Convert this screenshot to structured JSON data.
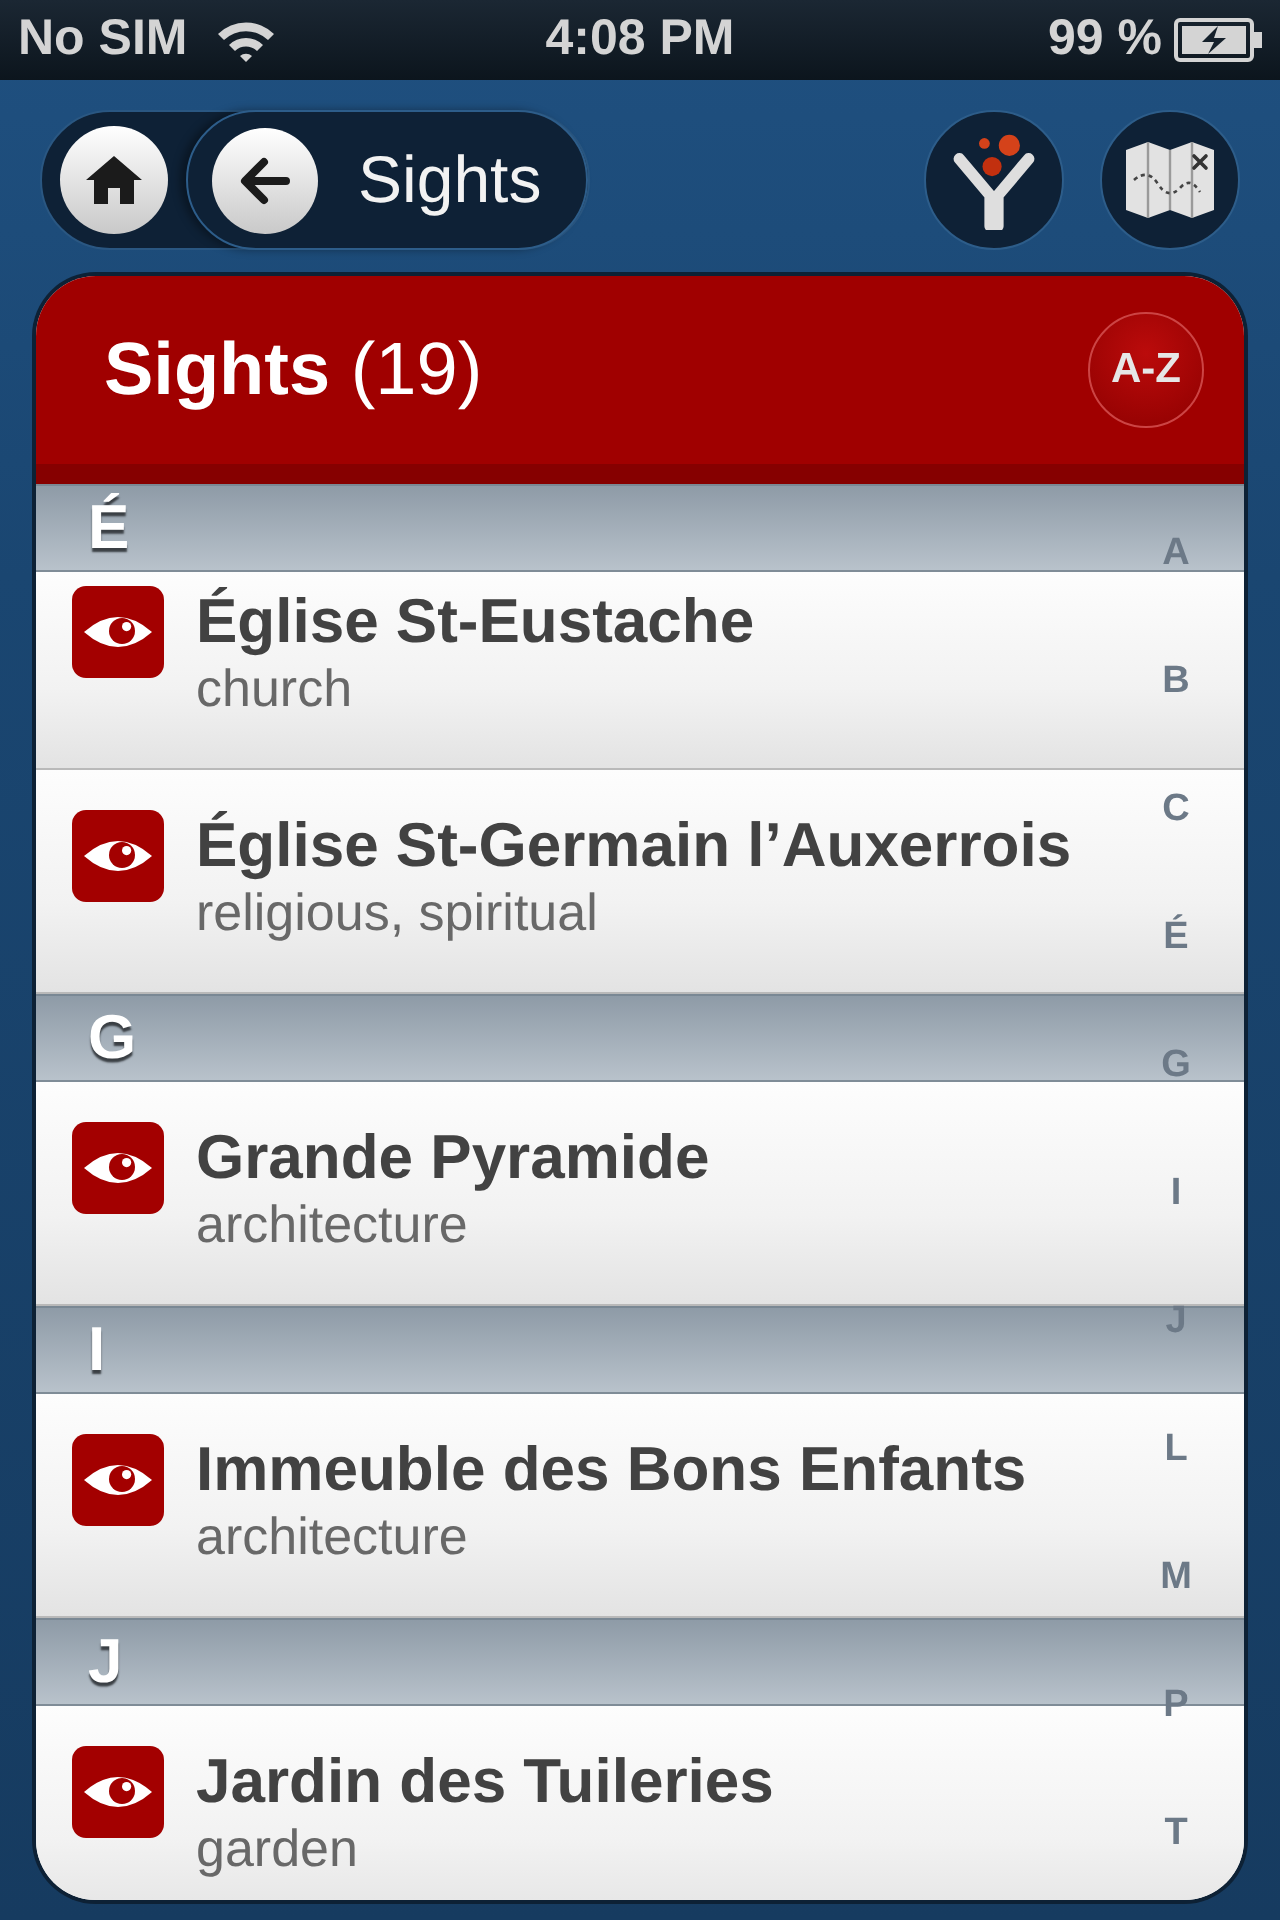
{
  "status_bar": {
    "carrier": "No SIM",
    "time": "4:08 PM",
    "battery": "99 %"
  },
  "nav": {
    "back_label": "Sights"
  },
  "header": {
    "title": "**Sights** (19)",
    "sort_label": "A-Z"
  },
  "sections": [
    {
      "letter": "É",
      "items": [
        {
          "name": "Église St-Eustache",
          "category": "church"
        },
        {
          "name": "Église St-Germain l’Auxerrois",
          "category": "religious, spiritual"
        }
      ]
    },
    {
      "letter": "G",
      "items": [
        {
          "name": "Grande Pyramide",
          "category": "architecture"
        }
      ]
    },
    {
      "letter": "I",
      "items": [
        {
          "name": "Immeuble des Bons Enfants",
          "category": "architecture"
        }
      ]
    },
    {
      "letter": "J",
      "items": [
        {
          "name": "Jardin des Tuileries",
          "category": "garden"
        }
      ]
    }
  ],
  "index": [
    "A",
    "B",
    "C",
    "É",
    "G",
    "I",
    "J",
    "L",
    "M",
    "P",
    "T"
  ]
}
